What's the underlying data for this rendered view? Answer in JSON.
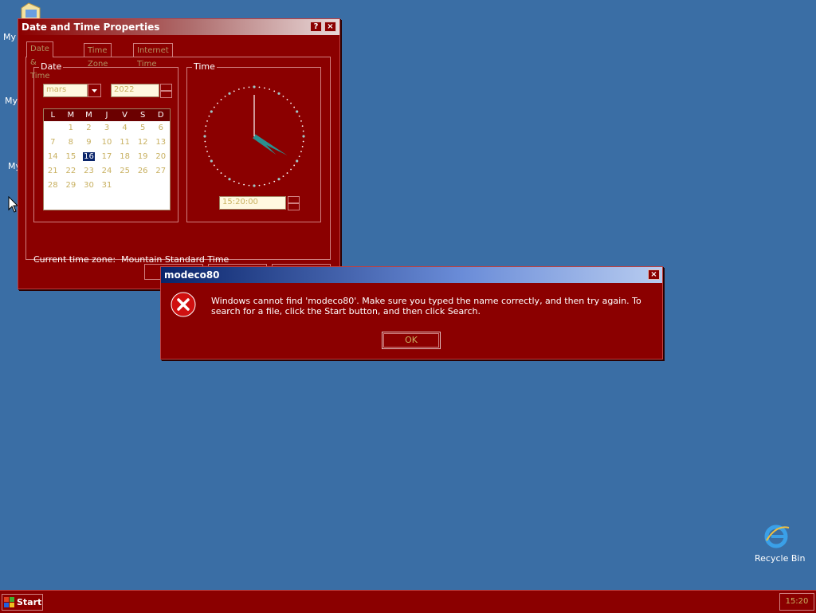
{
  "desktop": {
    "icons": [
      {
        "label": "My I"
      },
      {
        "label": "My"
      },
      {
        "label": "My"
      },
      {
        "label": "Recycle Bin"
      }
    ]
  },
  "date_time_window": {
    "title": "Date and Time Properties",
    "help_glyph": "?",
    "close_glyph": "×",
    "tabs": [
      "Date & Time",
      "Time Zone",
      "Internet Time"
    ],
    "date_group_label": "Date",
    "month_value": "mars",
    "year_value": "2022",
    "calendar": {
      "weekdays": [
        "L",
        "M",
        "M",
        "J",
        "V",
        "S",
        "D"
      ],
      "rows": [
        [
          "",
          "1",
          "2",
          "3",
          "4",
          "5",
          "6"
        ],
        [
          "7",
          "8",
          "9",
          "10",
          "11",
          "12",
          "13"
        ],
        [
          "14",
          "15",
          "16",
          "17",
          "18",
          "19",
          "20"
        ],
        [
          "21",
          "22",
          "23",
          "24",
          "25",
          "26",
          "27"
        ],
        [
          "28",
          "29",
          "30",
          "31",
          "",
          "",
          ""
        ],
        [
          "",
          "",
          "",
          "",
          "",
          "",
          ""
        ]
      ],
      "selected_day": "16"
    },
    "time_group_label": "Time",
    "time_value": "15:20:00",
    "clock": {
      "hour": 4,
      "minute": 20,
      "second": 0
    },
    "current_tz_label": "Current time zone:",
    "current_tz_value": "Mountain Standard Time"
  },
  "error_dialog": {
    "title": "modeco80",
    "close_glyph": "×",
    "message": "Windows cannot find 'modeco80'. Make sure you typed the name correctly, and then try again. To search for a file, click the Start button, and then click Search.",
    "ok_label": "OK"
  },
  "taskbar": {
    "start_label": "Start",
    "clock": "15:20"
  },
  "colors": {
    "desktop": "#3a6ea5",
    "window_face": "#8b0000",
    "active_title": "#0a246a",
    "disabled_text": "#c8b060"
  }
}
